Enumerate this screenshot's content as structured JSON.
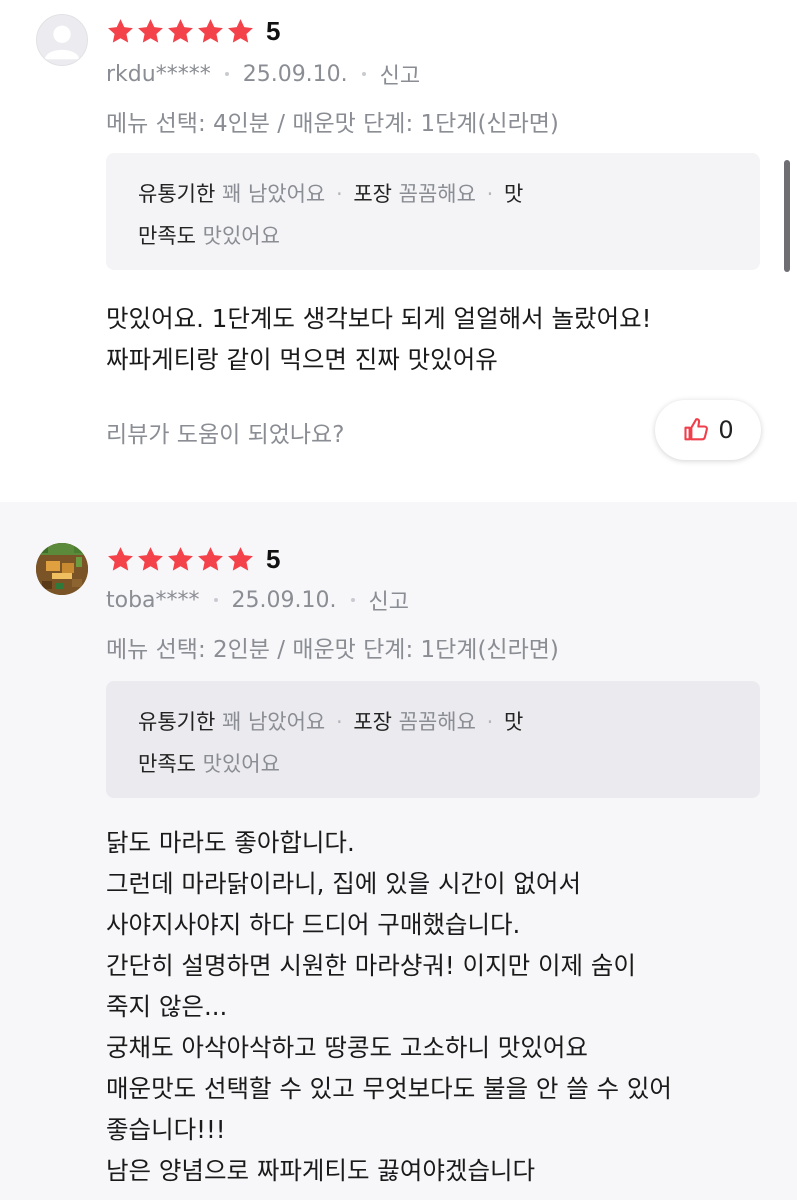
{
  "reviews": [
    {
      "avatar": "default-user-avatar",
      "rating": "5",
      "username": "rkdu*****",
      "date": "25.09.10.",
      "report_label": "신고",
      "menu_line": "메뉴 선택: 4인분 / 매운맛 단계: 1단계(신라면)",
      "attributes": [
        {
          "key": "유통기한",
          "value": "꽤 남았어요"
        },
        {
          "key": "포장",
          "value": "꼼꼼해요"
        },
        {
          "key": "맛",
          "value": ""
        },
        {
          "key": "만족도",
          "value": "맛있어요"
        }
      ],
      "body_lines": [
        "맛있어요. 1단계도 생각보다 되게 얼얼해서 놀랐어요!",
        "짜파게티랑 같이 먹으면 진짜 맛있어유"
      ],
      "helpful_question": "리뷰가 도움이 되었나요?",
      "like_count": "0"
    },
    {
      "avatar": "game-pixel-avatar",
      "rating": "5",
      "username": "toba****",
      "date": "25.09.10.",
      "report_label": "신고",
      "menu_line": "메뉴 선택: 2인분 / 매운맛 단계: 1단계(신라면)",
      "attributes": [
        {
          "key": "유통기한",
          "value": "꽤 남았어요"
        },
        {
          "key": "포장",
          "value": "꼼꼼해요"
        },
        {
          "key": "맛",
          "value": ""
        },
        {
          "key": "만족도",
          "value": "맛있어요"
        }
      ],
      "body_lines": [
        "닭도 마라도 좋아합니다.",
        "그런데 마라닭이라니, 집에 있을 시간이 없어서",
        "사야지사야지 하다 드디어 구매했습니다.",
        "간단히 설명하면 시원한 마라샹궈! 이지만 이제 숨이",
        "죽지 않은...",
        "궁채도 아삭아삭하고 땅콩도 고소하니 맛있어요",
        "매운맛도 선택할 수 있고 무엇보다도 불을 안 쓸 수 있어",
        "좋습니다!!!",
        "남은 양념으로 짜파게티도 끓여야겠습니다"
      ]
    }
  ],
  "colors": {
    "star": "#f4424b",
    "like_icon": "#f03e4a",
    "muted_text": "#8a8d93",
    "info_box_bg": "#f4f4f6",
    "review2_bg": "#f7f7f9"
  }
}
